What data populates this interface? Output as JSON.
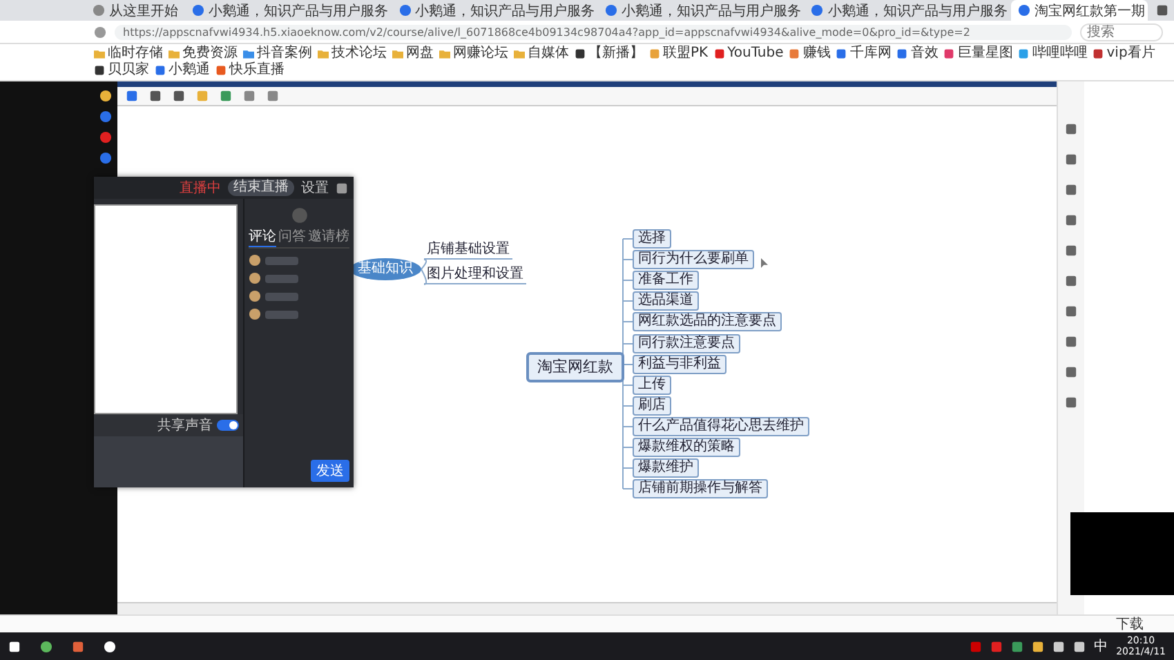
{
  "browser": {
    "tabs": [
      {
        "label": "从这里开始",
        "selected": false
      },
      {
        "label": "小鹅通，知识产品与用户服务",
        "selected": false
      },
      {
        "label": "小鹅通，知识产品与用户服务",
        "selected": false
      },
      {
        "label": "小鹅通，知识产品与用户服务",
        "selected": false
      },
      {
        "label": "小鹅通，知识产品与用户服务",
        "selected": false
      },
      {
        "label": "淘宝网红款第一期",
        "selected": true
      }
    ],
    "url": "https://appscnafvwi4934.h5.xiaoeknow.com/v2/course/alive/l_6071868ce4b09134c98704a4?app_id=appscnafvwi4934&alive_mode=0&pro_id=&type=2",
    "search": {
      "placeholder": "搜索"
    },
    "bookmarks": [
      "临时存储",
      "免费资源",
      "抖音案例",
      "技术论坛",
      "网盘",
      "网赚论坛",
      "自媒体",
      "【新播】",
      "联盟PK",
      "YouTube",
      "赚钱",
      "千库网",
      "音效",
      "巨量星图",
      "哔哩哔哩",
      "vip看片",
      "贝贝家",
      "小鹅通",
      "快乐直播"
    ]
  },
  "mindmap": {
    "root": {
      "label": "淘宝网红款",
      "children": [
        {
          "label": "选择"
        },
        {
          "label": "同行为什么要刷单"
        },
        {
          "label": "准备工作"
        },
        {
          "label": "选品渠道"
        },
        {
          "label": "网红款选品的注意要点"
        },
        {
          "label": "同行款注意要点"
        },
        {
          "label": "利益与非利益"
        },
        {
          "label": "上传"
        },
        {
          "label": "刷店"
        },
        {
          "label": "什么产品值得花心思去维护"
        },
        {
          "label": "爆款维权的策略"
        },
        {
          "label": "爆款维护"
        },
        {
          "label": "店铺前期操作与解答"
        }
      ]
    },
    "side_topic": {
      "label": "基础知识",
      "children": [
        {
          "label": "店铺基础设置"
        },
        {
          "label": "图片处理和设置"
        }
      ]
    }
  },
  "live_window": {
    "status": "直播中",
    "end_button": "结束直播",
    "settings": "设置",
    "tabs": [
      {
        "label": "评论",
        "selected": true
      },
      {
        "label": "问答",
        "selected": false
      },
      {
        "label": "邀请榜",
        "selected": false
      }
    ],
    "share_audio": {
      "label": "共享声音",
      "on": true
    },
    "send_button": "发送"
  },
  "download_bar": {
    "label": "下载"
  },
  "taskbar": {
    "time": "20:10",
    "date": "2021/4/11",
    "ime": "中"
  }
}
